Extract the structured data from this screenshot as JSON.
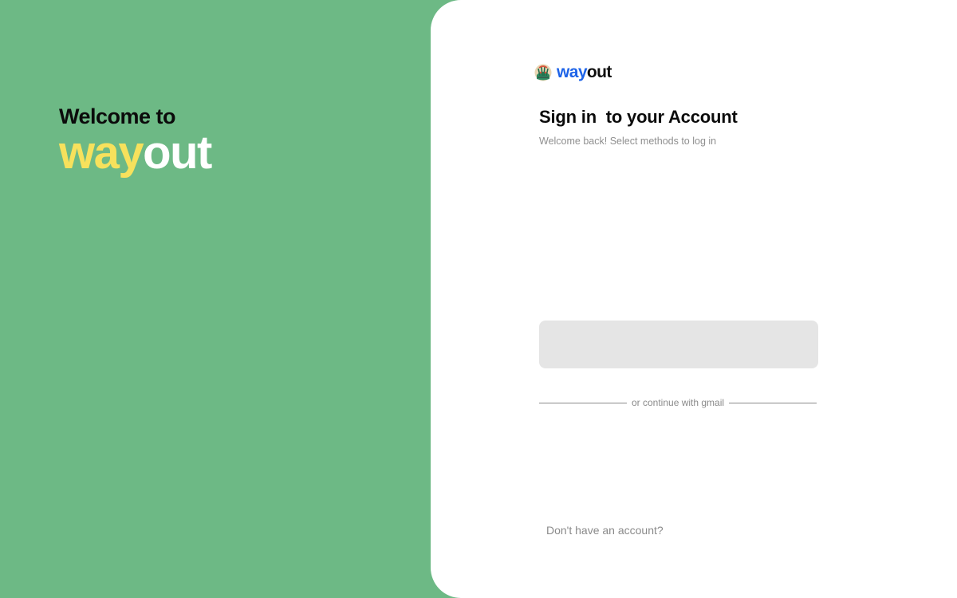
{
  "welcome": {
    "line1": "Welcome to",
    "brand_part1": "way",
    "brand_part2": "out"
  },
  "logo": {
    "icon": "wayout-logo-icon",
    "brand_part1": "way",
    "brand_part2": "out"
  },
  "signin": {
    "title": "Sign in  to your Account",
    "subtitle": "Welcome back! Select methods to log in"
  },
  "divider": {
    "text": "or continue with gmail"
  },
  "footer": {
    "signup_prompt": "Don't have an account?"
  },
  "colors": {
    "left_background": "#6db985",
    "brand_yellow": "#f7e15c",
    "brand_blue": "#1d63e8",
    "placeholder_gray": "#e5e5e5"
  }
}
